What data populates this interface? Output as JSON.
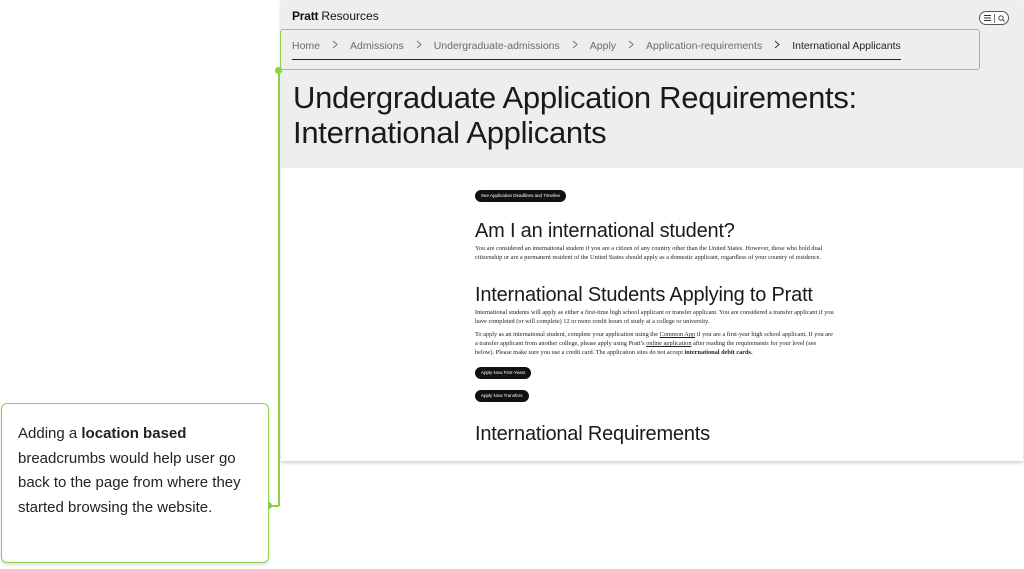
{
  "site": {
    "logo": "Pratt",
    "logo_sub": "Resources",
    "menu_icon": "hamburger-icon",
    "search_icon": "search-icon",
    "breadcrumb": [
      {
        "label": "Home"
      },
      {
        "label": "Admissions"
      },
      {
        "label": "Undergraduate-admissions"
      },
      {
        "label": "Apply"
      },
      {
        "label": "Application-requirements"
      },
      {
        "label": "International Applicants"
      }
    ],
    "title_line1": "Undergraduate Application Requirements:",
    "title_line2": "International Applicants",
    "deadlines_button": "See Application Deadlines and Timeline",
    "section1_heading": "Am I an international student?",
    "section1_text": "You are considered an international student if you are a citizen of any country other than the United States. However, those who hold dual citizenship or are a permanent resident of the United States should apply as a domestic applicant, regardless of your country of residence.",
    "section2_heading": "International Students Applying to Pratt",
    "section2_text1": "International students will apply as either a first-time high school applicant or transfer applicant. You are considered a transfer applicant if you have completed (or will complete) 12 or more credit hours of study at a college or university.",
    "section2_text2_a": "To apply as an international student, complete your application using the ",
    "section2_text2_link1": "Common App",
    "section2_text2_b": " if you are a first-year high school applicant. If you are a transfer applicant from another college, please apply using Pratt’s ",
    "section2_text2_link2": "online application",
    "section2_text2_c": " after reading the requirements for your level  (see below). Please make sure you use a credit card. The application sites do not accept ",
    "section2_text2_bold": "international debit cards.",
    "apply_first_years": "Apply Now First-Years",
    "apply_transfers": "Apply Now Transfers",
    "section3_heading": "International Requirements"
  },
  "annotation": {
    "text_a": "Adding a ",
    "text_bold": "location based",
    "text_b": " breadcrumbs would help user go back to the page from where they started browsing the website."
  },
  "colors": {
    "highlight": "#8bd14c",
    "hero_bg": "#efeeee",
    "button_bg": "#111111"
  }
}
